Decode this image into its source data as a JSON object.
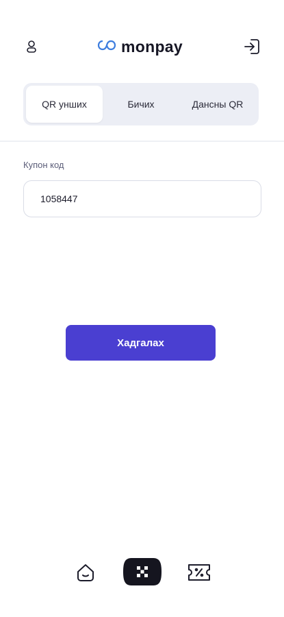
{
  "header": {
    "brand_name": "monpay",
    "profile_icon": "user-icon",
    "logout_icon": "logout-icon",
    "brand_color": "#3d7dde"
  },
  "tabs": [
    {
      "label": "QR уншиx",
      "active": true
    },
    {
      "label": "Бичиx",
      "active": false
    },
    {
      "label": "Дансны QR",
      "active": false
    }
  ],
  "coupon": {
    "label": "Купон код",
    "value": "1058447"
  },
  "actions": {
    "save_label": "Хадгалах",
    "accent_color": "#4a3fd1"
  },
  "bottom_nav": {
    "items": [
      {
        "icon": "home-smile-icon"
      },
      {
        "icon": "scan-qr-icon",
        "active": true
      },
      {
        "icon": "coupon-percent-icon"
      }
    ]
  }
}
